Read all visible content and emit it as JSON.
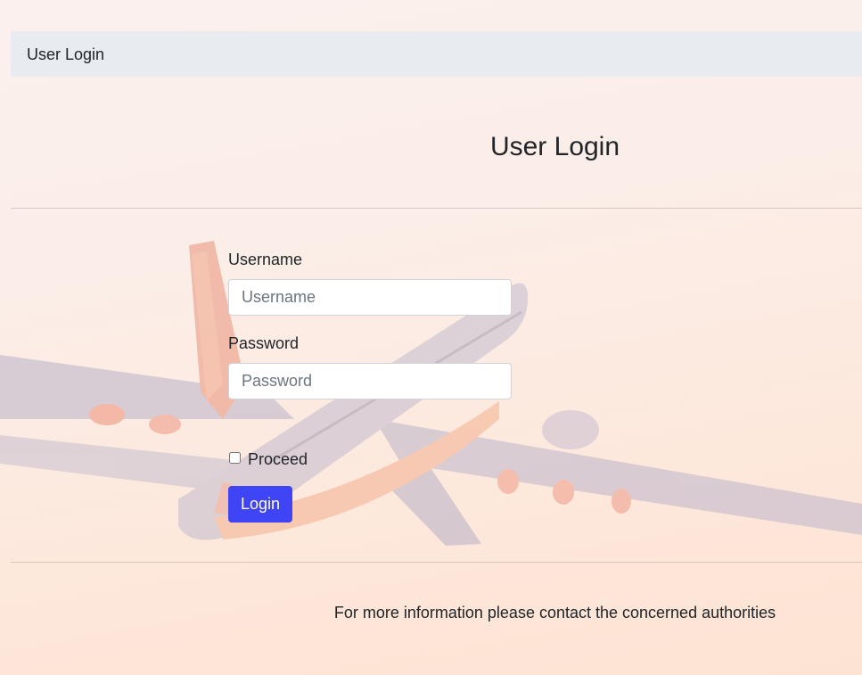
{
  "navbar": {
    "brand": "User Login"
  },
  "page": {
    "title": "User Login"
  },
  "form": {
    "username_label": "Username",
    "username_placeholder": "Username",
    "username_value": "",
    "password_label": "Password",
    "password_placeholder": "Password",
    "password_value": "",
    "proceed_label": "Proceed",
    "proceed_checked": false,
    "login_label": "Login"
  },
  "footer": {
    "text": "For more information please contact the concerned authorities"
  },
  "colors": {
    "accent": "#3f44f5",
    "navbar_bg": "#e8ebef"
  }
}
